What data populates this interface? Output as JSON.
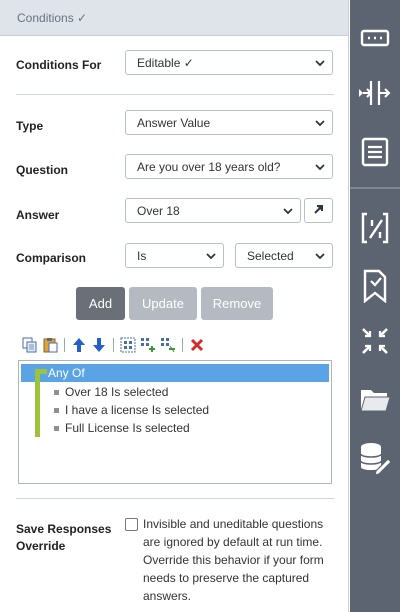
{
  "header": {
    "title": "Conditions ✓"
  },
  "conditions_for": {
    "label": "Conditions For",
    "value": "Editable ✓"
  },
  "type": {
    "label": "Type",
    "value": "Answer Value"
  },
  "question": {
    "label": "Question",
    "value": "Are you over 18 years old?"
  },
  "answer": {
    "label": "Answer",
    "value": "Over 18"
  },
  "comparison": {
    "label": "Comparison",
    "operator": "Is",
    "value": "Selected"
  },
  "buttons": {
    "add": "Add",
    "update": "Update",
    "remove": "Remove"
  },
  "toolbar": {
    "icons": [
      "copy-icon",
      "paste-icon",
      "move-up-icon",
      "move-down-icon",
      "group-icon",
      "group-add-icon",
      "group-remove-icon",
      "delete-icon"
    ]
  },
  "tree": {
    "root": "Any Of",
    "items": [
      "Over 18 Is selected",
      "I have a license Is selected",
      "Full License Is selected"
    ]
  },
  "save_responses": {
    "label": "Save Responses Override",
    "checked": false,
    "description": "Invisible and uneditable questions are ignored by default at run time. Override this behavior if your form needs to preserve the captured answers."
  },
  "sidebar": {
    "icons": [
      "form-field-icon",
      "merge-flow-icon",
      "list-document-icon",
      "code-variable-icon",
      "page-bookmark-icon",
      "collapse-arrows-icon",
      "folder-icon",
      "database-edit-icon"
    ]
  },
  "colors": {
    "selection": "#5aa4e6",
    "tree_bar": "#9dc33b",
    "sidebar": "#5c6472",
    "add_button": "#6a6f78",
    "disabled_button": "#b4b9c2"
  }
}
